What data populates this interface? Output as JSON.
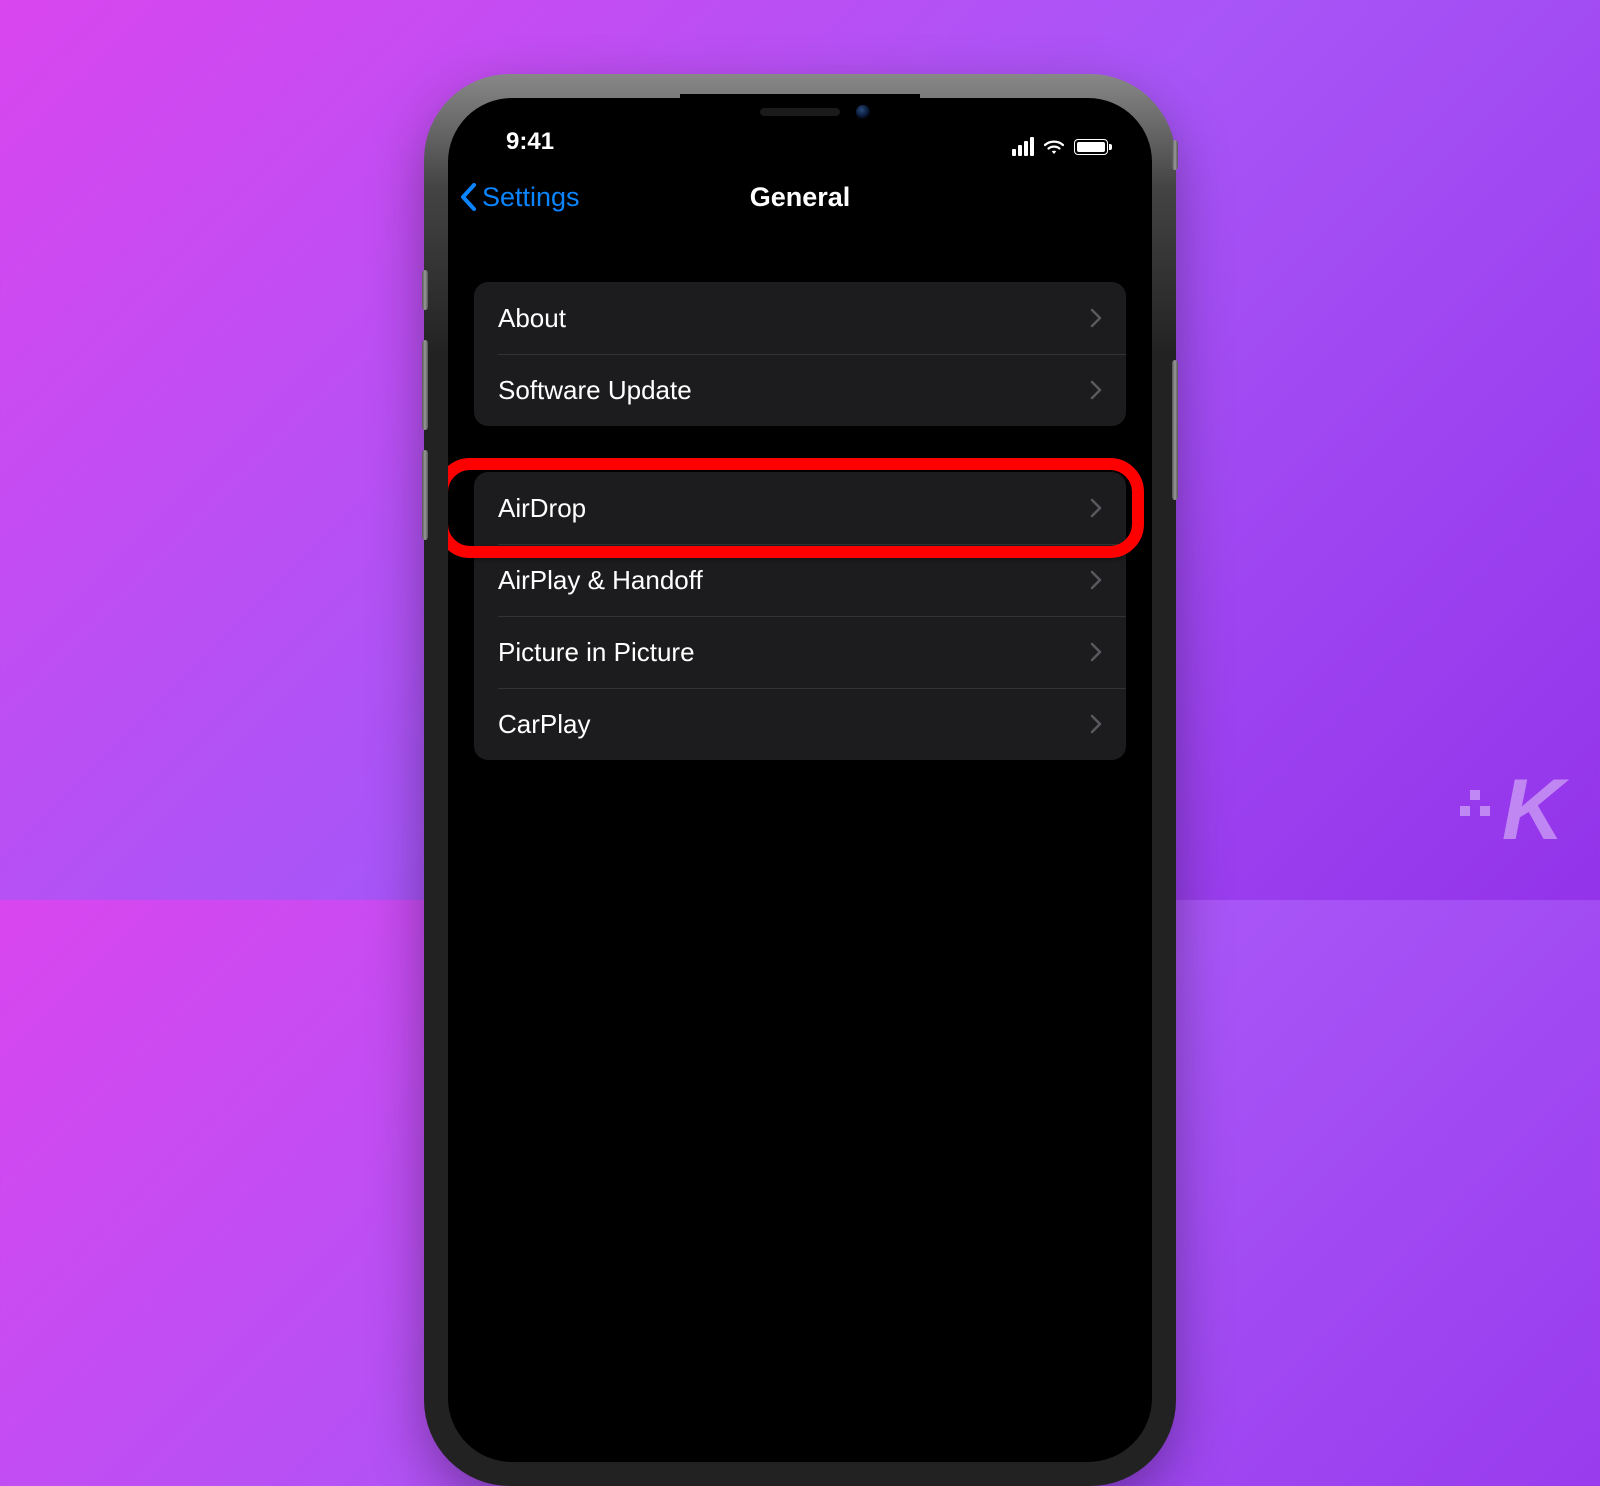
{
  "status_bar": {
    "time": "9:41"
  },
  "nav": {
    "back_label": "Settings",
    "title": "General"
  },
  "groups": [
    {
      "rows": [
        {
          "label": "About"
        },
        {
          "label": "Software Update"
        }
      ]
    },
    {
      "rows": [
        {
          "label": "AirDrop",
          "highlighted": true
        },
        {
          "label": "AirPlay & Handoff"
        },
        {
          "label": "Picture in Picture"
        },
        {
          "label": "CarPlay"
        }
      ]
    }
  ],
  "annotation": {
    "highlight_color": "#ff0000"
  },
  "watermark": {
    "text": "K"
  }
}
